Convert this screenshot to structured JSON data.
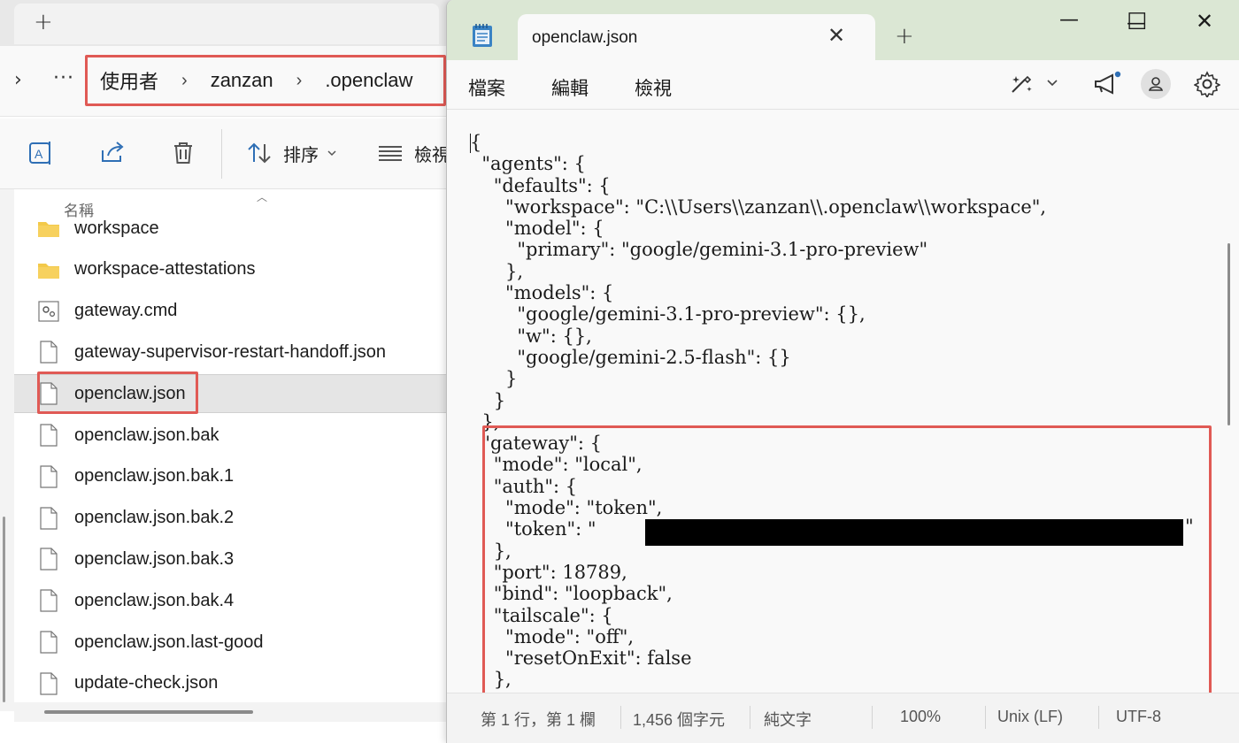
{
  "explorer": {
    "new_tab_label": "+",
    "nav_chevron": "›",
    "more_label": "···",
    "breadcrumb": [
      "使用者",
      "zanzan",
      ".openclaw"
    ],
    "breadcrumb_sep": "›",
    "toolbar": {
      "sort_label": "排序",
      "view_label": "檢視"
    },
    "column_header": "名稱",
    "files": [
      {
        "name": "workspace",
        "type": "folder"
      },
      {
        "name": "workspace-attestations",
        "type": "folder"
      },
      {
        "name": "gateway.cmd",
        "type": "cmd"
      },
      {
        "name": "gateway-supervisor-restart-handoff.json",
        "type": "file"
      },
      {
        "name": "openclaw.json",
        "type": "file",
        "selected": true
      },
      {
        "name": "openclaw.json.bak",
        "type": "file"
      },
      {
        "name": "openclaw.json.bak.1",
        "type": "file"
      },
      {
        "name": "openclaw.json.bak.2",
        "type": "file"
      },
      {
        "name": "openclaw.json.bak.3",
        "type": "file"
      },
      {
        "name": "openclaw.json.bak.4",
        "type": "file"
      },
      {
        "name": "openclaw.json.last-good",
        "type": "file"
      },
      {
        "name": "update-check.json",
        "type": "file"
      }
    ]
  },
  "notepad": {
    "tab_title": "openclaw.json",
    "tab_close": "✕",
    "new_tab": "+",
    "window": {
      "minimize": "—",
      "maximize": "☐",
      "close": "✕"
    },
    "menu": [
      "檔案",
      "編輯",
      "檢視"
    ],
    "code_lines": [
      "{",
      "  \"agents\": {",
      "    \"defaults\": {",
      "      \"workspace\": \"C:\\\\Users\\\\zanzan\\\\.openclaw\\\\workspace\",",
      "      \"model\": {",
      "        \"primary\": \"google/gemini-3.1-pro-preview\"",
      "      },",
      "      \"models\": {",
      "        \"google/gemini-3.1-pro-preview\": {},",
      "        \"w\": {},",
      "        \"google/gemini-2.5-flash\": {}",
      "      }",
      "    }",
      "  },",
      "  \"gateway\": {",
      "    \"mode\": \"local\",",
      "    \"auth\": {",
      "      \"mode\": \"token\",",
      "      \"token\": \"",
      "    },",
      "    \"port\": 18789,",
      "    \"bind\": \"loopback\",",
      "    \"tailscale\": {",
      "      \"mode\": \"off\",",
      "      \"resetOnExit\": false",
      "    },"
    ],
    "redact_close_quote": "\"",
    "status": {
      "position": "第 1 行，第 1 欄",
      "chars": "1,456 個字元",
      "format": "純文字",
      "zoom": "100%",
      "line_ending": "Unix (LF)",
      "encoding": "UTF-8"
    },
    "colors": {
      "titlebar": "#dbe7d4",
      "highlight": "#e05a55"
    }
  }
}
